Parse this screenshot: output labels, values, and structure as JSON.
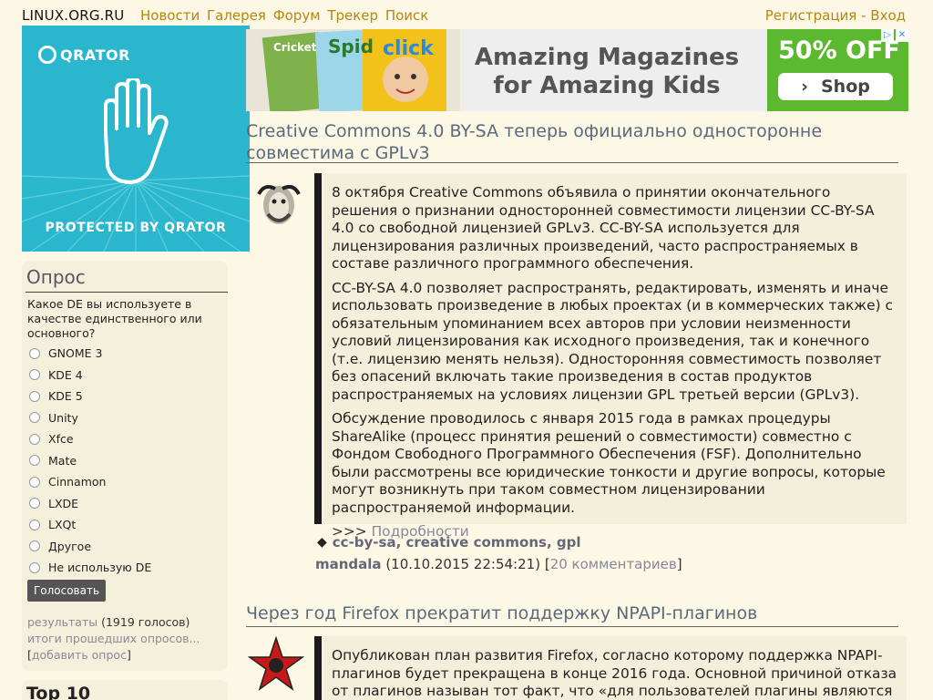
{
  "header": {
    "site_title": "LINUX.ORG.RU",
    "nav": [
      "Новости",
      "Галерея",
      "Форум",
      "Трекер",
      "Поиск"
    ],
    "register": "Регистрация",
    "separator": " - ",
    "login": "Вход"
  },
  "ad_qrator": {
    "logo_text": "QRATOR",
    "tagline": "PROTECTED BY QRATOR",
    "bg_color": "#2ab6cc"
  },
  "ad_magazines": {
    "headline_line1": "Amazing Magazines",
    "headline_line2": "for Amazing Kids",
    "offer": "50% OFF",
    "button": "Shop",
    "cover_titles": [
      "Cricket",
      "Spid",
      "click"
    ]
  },
  "poll": {
    "title": "Опрос",
    "question": "Какое DE вы используете в качестве единственного или основного?",
    "options": [
      "GNOME 3",
      "KDE 4",
      "KDE 5",
      "Unity",
      "Xfce",
      "Mate",
      "Cinnamon",
      "LXDE",
      "LXQt",
      "Другое",
      "Не использую DE"
    ],
    "vote_button": "Голосовать",
    "results_link": "результаты",
    "votes_count": " (1919 голосов)",
    "past_polls_link": "итоги прошедших опросов...",
    "add_poll_link": "добавить опрос"
  },
  "top10": {
    "title": "Top 10"
  },
  "articles": [
    {
      "title": "Creative Commons 4.0 BY-SA теперь официально односторонне совместима с GPLv3",
      "paragraphs": [
        "8 октября Creative Commons объявила о принятии окончательного решения о признании односторонней совместимости лицензии CC-BY-SA 4.0 со свободной лицензией GPLv3. CC-BY-SA используется для лицензирования различных произведений, часто распространяемых в составе различного программного обеспечения.",
        "CC-BY-SA 4.0 позволяет распространять, редактировать, изменять и иначе использовать произведение в любых проектах (и в коммерческих также) с обязательным упоминанием всех авторов при условии неизменности условий лицензирования как исходного произведения, так и конечного (т.е. лицензию менять нельзя). Односторонняя совместимость позволяет без опасений включать такие произведения в состав продуктов распространяемых на условиях лицензии GPL третьей версии (GPLv3).",
        "Обсуждение проводилось с января 2015 года в рамках процедуры ShareAlike (процесс принятия решений о совместимости) совместно с Фондом Свободного Программного Обеспечения (FSF). Дополнительно были рассмотрены все юридические тонкости и другие вопросы, которые могут возникнуть при таком совместном лицензировании распространяемой информации."
      ],
      "more_prefix": ">>> ",
      "more_link": "Подробности",
      "tags": "cc-by-sa, creative commons, gpl",
      "author": "mandala",
      "date": " (10.10.2015 22:54:21) ",
      "comments": "20 комментариев"
    },
    {
      "title": "Через год Firefox прекратит поддержку NPAPI-плагинов",
      "paragraphs": [
        "Опубликован план развития Firefox, согласно которому поддержка NPAPI-плагинов будет прекращена в конце 2016 года. Основной причиной отказа от плагинов называн тот факт, что «для пользователей плагины являются источником проблем"
      ]
    }
  ]
}
